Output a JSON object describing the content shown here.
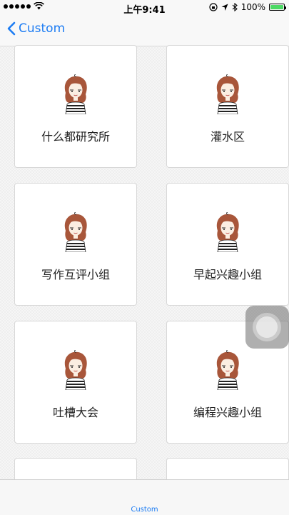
{
  "status_bar": {
    "carrier_icon": "signal-dots-icon",
    "time": "上午9:41",
    "battery": "100%"
  },
  "nav": {
    "back_label": "Custom"
  },
  "groups": [
    {
      "name": "什么都研究所"
    },
    {
      "name": "灌水区"
    },
    {
      "name": "写作互评小组"
    },
    {
      "name": "早起兴趣小组"
    },
    {
      "name": "吐槽大会"
    },
    {
      "name": "编程兴趣小组"
    }
  ],
  "tab_bar": {
    "tab_label": "Custom"
  },
  "colors": {
    "accent": "#1c7cf3",
    "battery": "#4cd964"
  }
}
